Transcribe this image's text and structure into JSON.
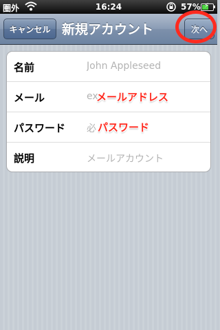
{
  "status_bar": {
    "carrier": "圏外",
    "time": "16:24",
    "battery_percent": "57%",
    "battery_level": 0.57,
    "battery_color": "#4fd443"
  },
  "navbar": {
    "cancel_label": "キャンセル",
    "title": "新規アカウント",
    "next_label": "次へ"
  },
  "form": {
    "rows": [
      {
        "label": "名前",
        "placeholder": "John Appleseed"
      },
      {
        "label": "メール",
        "placeholder": "ex"
      },
      {
        "label": "パスワード",
        "placeholder": "必"
      },
      {
        "label": "説明",
        "placeholder": "メールアカウント"
      }
    ]
  },
  "annotations": {
    "email_note": "メールアドレス",
    "password_note": "パスワード",
    "color": "#ff2a1f"
  }
}
